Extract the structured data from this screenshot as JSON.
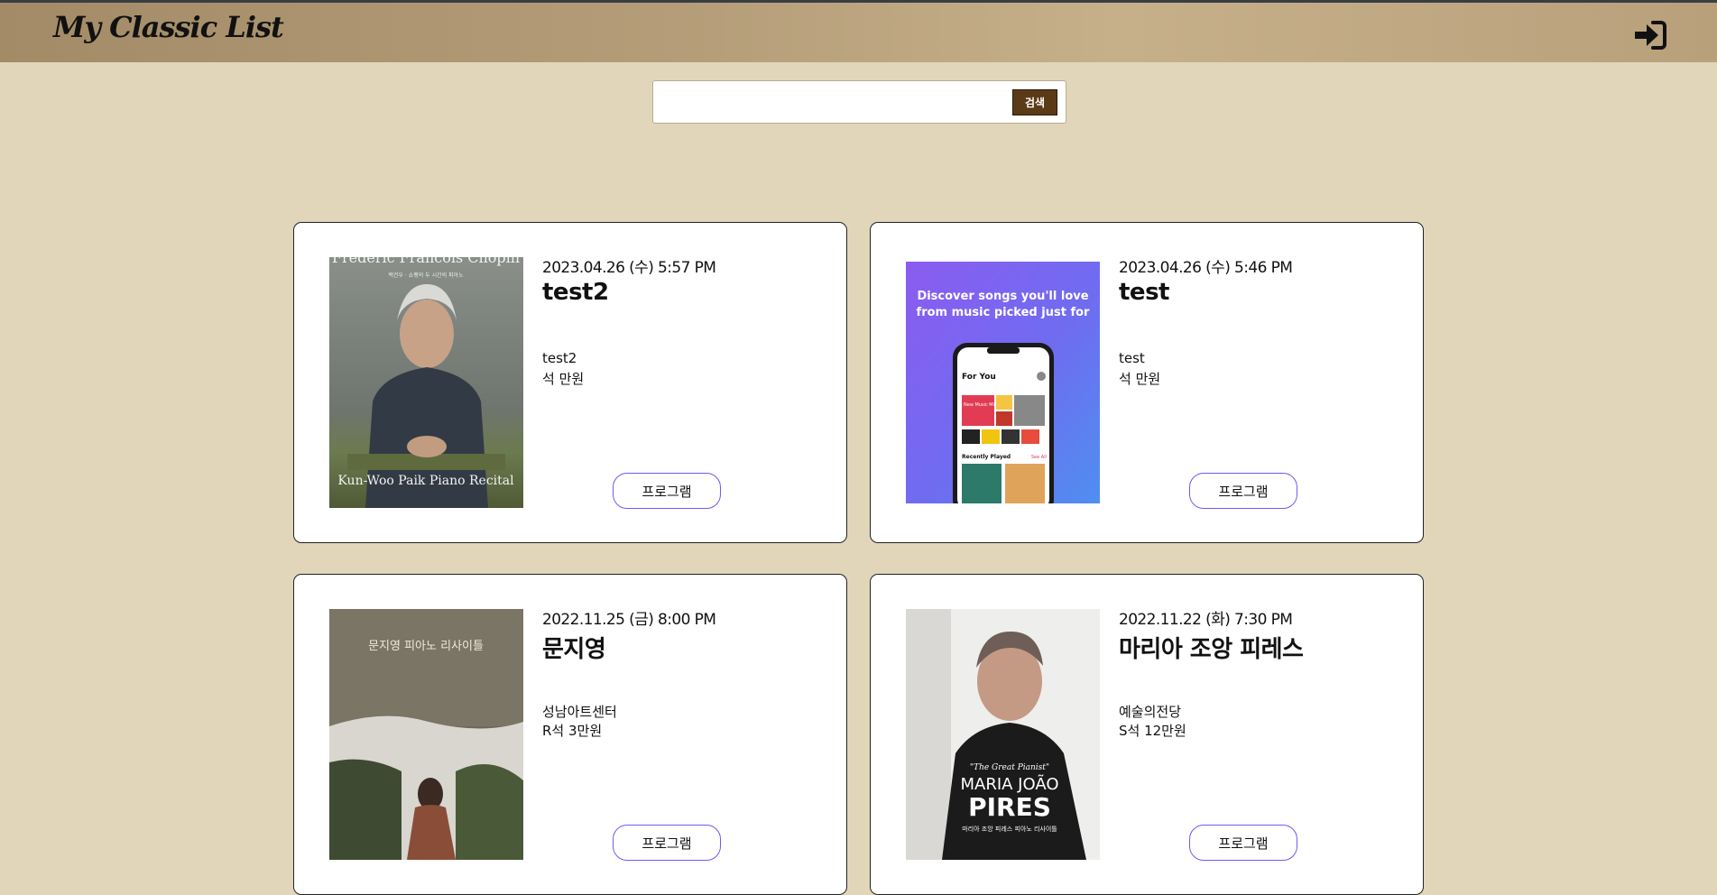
{
  "header": {
    "logo": "My Classic List",
    "login_icon": "sign-in-icon"
  },
  "search": {
    "value": "",
    "placeholder": "",
    "button_label": "검색"
  },
  "concerts": [
    {
      "date": "2023.04.26 (수) 5:57 PM",
      "title": "test2",
      "venue": "test2",
      "price": "석 만원",
      "button_label": "프로그램",
      "poster": {
        "top_text": "Frederic Francois Chopin",
        "sub_text": "백건우 · 쇼팽의 두 시간의 피아노",
        "bottom_text": "Kun-Woo Paik Piano Recital"
      }
    },
    {
      "date": "2023.04.26 (수) 5:46 PM",
      "title": "test",
      "venue": "test",
      "price": "석 만원",
      "button_label": "프로그램",
      "poster": {
        "top_text": "Discover songs you'll love from music picked just for you.",
        "screen_title": "For You",
        "tile_label": "New Music Mix",
        "section_label": "Recently Played",
        "see_all": "See All"
      }
    },
    {
      "date": "2022.11.25 (금) 8:00 PM",
      "title": "문지영",
      "venue": "성남아트센터",
      "price": "R석 3만원",
      "button_label": "프로그램",
      "poster": {
        "top_text": "문지영 피아노 리사이틀"
      }
    },
    {
      "date": "2022.11.22 (화) 7:30 PM",
      "title": "마리아 조앙 피레스",
      "venue": "예술의전당",
      "price": "S석 12만원",
      "button_label": "프로그램",
      "poster": {
        "tagline": "\"The Great Pianist\"",
        "name_line1": "MARIA JOÃO",
        "name_line2": "PIRES",
        "sub_text": "마리아 조앙 피레스 피아노 리사이틀"
      }
    }
  ]
}
